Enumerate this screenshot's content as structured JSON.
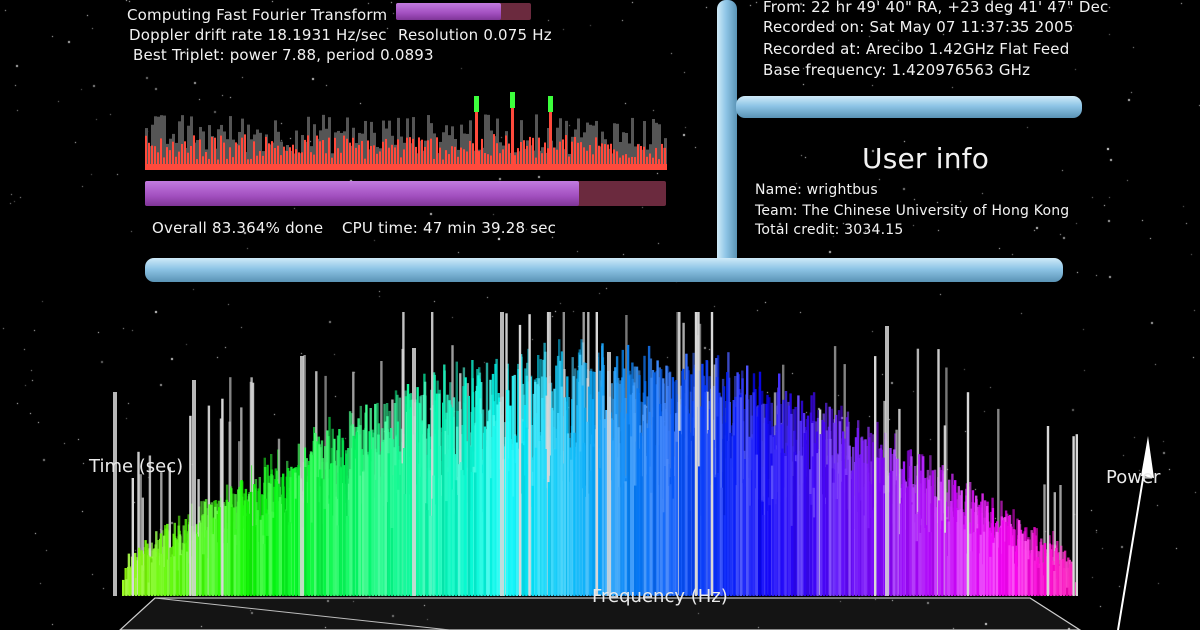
{
  "analysis": {
    "status_line": "Computing Fast Fourier Transform",
    "status_progress": 0.78,
    "doppler_line": "Doppler drift rate 18.1931 Hz/sec",
    "resolution_line": "Resolution 0.075 Hz",
    "triplet_line": "Best Triplet: power 7.88, period 0.0893",
    "overall_line": "Overall 83.364% done",
    "overall_progress": 0.83364,
    "cpu_line": "CPU time: 47 min 39.28 sec"
  },
  "data_info": {
    "from_line": "From: 22 hr 49' 40\" RA, +23 deg 41' 47\" Dec",
    "recorded_on_line": "Recorded on: Sat May 07 11:37:35 2005",
    "recorded_at_line": "Recorded at: Arecibo 1.42GHz Flat Feed",
    "base_freq_line": "Base frequency: 1.420976563 GHz"
  },
  "user_info": {
    "title": "User info",
    "name_line": "Name: wrightbus",
    "team_line": "Team: The Chinese University of Hong Kong",
    "credit_line": "Total credit: 3034.15"
  },
  "spectrum": {
    "time_label": "Time (sec)",
    "frequency_label": "Frequency (Hz)",
    "power_label": "Power"
  },
  "colors": {
    "pipe": "#8ec5e6",
    "progress_fill": "#a24fbf",
    "progress_track": "#6b2a3e",
    "triplet_red": "#ff4a3c",
    "triplet_gray": "#555555",
    "triplet_green": "#3cff3c"
  }
}
